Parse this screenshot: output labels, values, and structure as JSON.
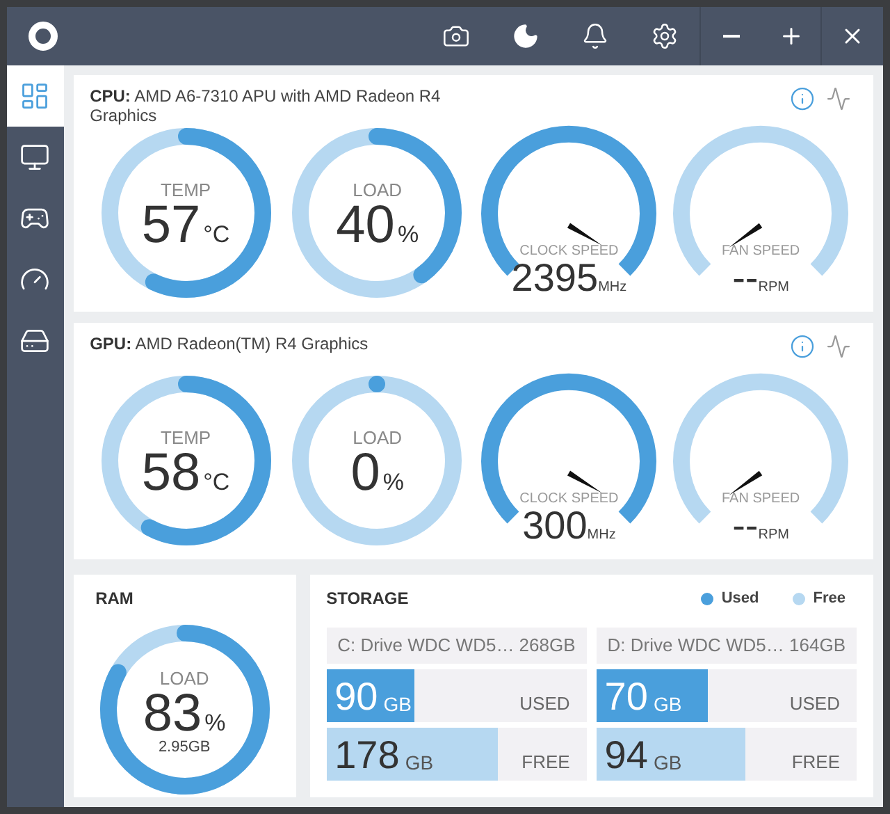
{
  "sidebar": {
    "items": [
      {
        "kind": "dashboard",
        "selected": true
      },
      {
        "kind": "monitor",
        "selected": false
      },
      {
        "kind": "gamepad",
        "selected": false
      },
      {
        "kind": "gauge",
        "selected": false
      },
      {
        "kind": "disk",
        "selected": false
      }
    ]
  },
  "cpu": {
    "label": "CPU:",
    "name": "AMD A6-7310 APU with AMD Radeon R4 Graphics",
    "gauges": [
      {
        "kind": "ring",
        "label": "TEMP",
        "value": "57",
        "unit": "°C",
        "level": 0.57
      },
      {
        "kind": "ring",
        "label": "LOAD",
        "value": "40",
        "unit": "%",
        "level": 0.4
      },
      {
        "kind": "dial",
        "label": "CLOCK SPEED",
        "value": "2395",
        "unit": "MHz",
        "active": true
      },
      {
        "kind": "dial",
        "label": "FAN SPEED",
        "value": "--",
        "unit": "RPM",
        "active": false
      }
    ]
  },
  "gpu": {
    "label": "GPU:",
    "name": "AMD Radeon(TM) R4 Graphics",
    "gauges": [
      {
        "kind": "ring",
        "label": "TEMP",
        "value": "58",
        "unit": "°C",
        "level": 0.58
      },
      {
        "kind": "ring",
        "label": "LOAD",
        "value": "0",
        "unit": "%",
        "level": 0
      },
      {
        "kind": "dial",
        "label": "CLOCK SPEED",
        "value": "300",
        "unit": "MHz",
        "active": true
      },
      {
        "kind": "dial",
        "label": "FAN SPEED",
        "value": "--",
        "unit": "RPM",
        "active": false
      }
    ]
  },
  "ram": {
    "title": "RAM",
    "label": "LOAD",
    "value": "83",
    "unit": "%",
    "detail": "2.95GB",
    "level": 0.83
  },
  "storage": {
    "title": "STORAGE",
    "legend": [
      {
        "label": "Used",
        "color": "#4a9fdc"
      },
      {
        "label": "Free",
        "color": "#b6d8f1"
      }
    ],
    "drives": [
      {
        "name": "C: Drive WDC WD5… 268GB",
        "used": {
          "value": "90",
          "unit": "GB",
          "label": "USED",
          "level": 0.34
        },
        "free": {
          "value": "178",
          "unit": "GB",
          "label": "FREE",
          "level": 0.66
        }
      },
      {
        "name": "D: Drive WDC WD5… 164GB",
        "used": {
          "value": "70",
          "unit": "GB",
          "label": "USED",
          "level": 0.43
        },
        "free": {
          "value": "94",
          "unit": "GB",
          "label": "FREE",
          "level": 0.57
        }
      }
    ]
  }
}
